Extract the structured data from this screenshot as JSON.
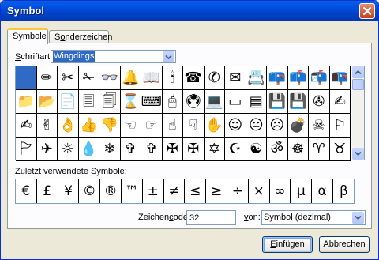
{
  "window": {
    "title": "Symbol"
  },
  "tabs": [
    {
      "label": "Symbole",
      "accel": "S",
      "rest": "ymbole"
    },
    {
      "label": "Sonderzeichen",
      "accel": "o",
      "pre": "S",
      "rest": "nderzeichen"
    }
  ],
  "font": {
    "label_accel": "S",
    "label_rest": "chriftart:",
    "label": "Schriftart:",
    "value": "Wingdings"
  },
  "symbol_grid": {
    "rows": [
      [
        "",
        "✏",
        "✂",
        "✁",
        "👓",
        "🔔",
        "📖",
        "🕯",
        "☎",
        "✆",
        "✉",
        "📇",
        "📪",
        "📫",
        "📬",
        "📭"
      ],
      [
        "📁",
        "📂",
        "📄",
        "🗏",
        "🗐",
        "⌛",
        "⌨",
        "🖱",
        "🖲",
        "💻",
        "▭",
        "▤",
        "💾",
        "💾",
        "✇",
        "✍"
      ],
      [
        "✍",
        "✌",
        "👌",
        "👍",
        "👎",
        "☜",
        "☞",
        "☝",
        "☟",
        "✋",
        "☺",
        "😐",
        "☹",
        "💣",
        "☠",
        "⚐"
      ],
      [
        "🏱",
        "✈",
        "☼",
        "💧",
        "❄",
        "✞",
        "✞",
        "✠",
        "✠",
        "✡",
        "☪",
        "☯",
        "ॐ",
        "☸",
        "♈",
        "♉"
      ]
    ]
  },
  "recent": {
    "label_pre": "",
    "label_accel": "Z",
    "label_rest": "uletzt verwendete Symbole:",
    "label": "Zuletzt verwendete Symbole:",
    "symbols": [
      "€",
      "£",
      "¥",
      "©",
      "®",
      "™",
      "±",
      "≠",
      "≤",
      "≥",
      "÷",
      "×",
      "∞",
      "μ",
      "α",
      "β"
    ]
  },
  "charcode": {
    "label": "Zeichencode:",
    "label_pre": "Zeichen",
    "label_accel": "c",
    "label_rest": "ode:",
    "value": "32"
  },
  "from": {
    "label": "von:",
    "label_accel": "v",
    "label_rest": "on:",
    "value": "Symbol (dezimal)"
  },
  "buttons": {
    "insert": "Einfügen",
    "insert_accel": "E",
    "insert_rest": "infügen",
    "cancel": "Abbrechen"
  },
  "icons": {
    "close": "close-icon",
    "dropdown": "chevron-down-icon",
    "scroll_up": "scroll-up-arrow-icon",
    "scroll_down": "scroll-down-arrow-icon"
  },
  "colors": {
    "selection": "#316AC5",
    "title_bar": "#0054E3",
    "tab_highlight": "#FFC83C"
  }
}
